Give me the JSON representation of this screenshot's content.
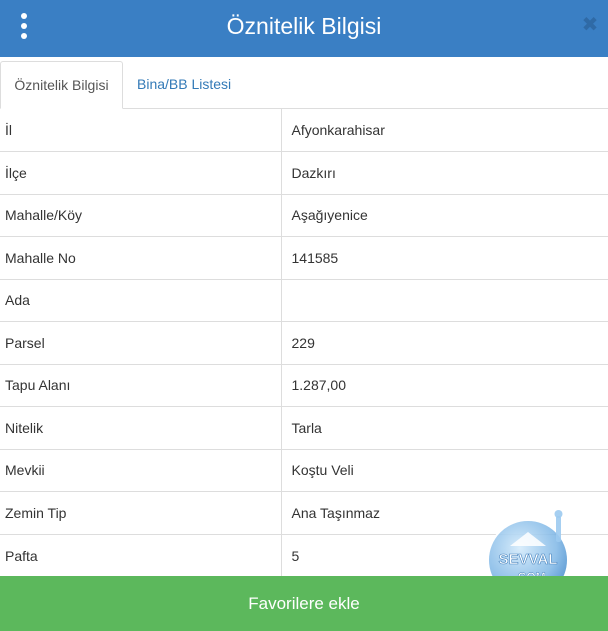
{
  "header": {
    "title": "Öznitelik Bilgisi",
    "menu_icon": "vertical-dots-icon",
    "close_icon": "close-icon",
    "color": "#3a7fc4"
  },
  "tabs": [
    {
      "label": "Öznitelik Bilgisi",
      "active": true
    },
    {
      "label": "Bina/BB Listesi",
      "active": false
    }
  ],
  "attributes": [
    {
      "key": "İl",
      "value": "Afyonkarahisar"
    },
    {
      "key": "İlçe",
      "value": "Dazkırı"
    },
    {
      "key": "Mahalle/Köy",
      "value": "Aşağıyenice"
    },
    {
      "key": "Mahalle No",
      "value": "141585"
    },
    {
      "key": "Ada",
      "value": ""
    },
    {
      "key": "Parsel",
      "value": "229"
    },
    {
      "key": "Tapu Alanı",
      "value": "1.287,00"
    },
    {
      "key": "Nitelik",
      "value": "Tarla"
    },
    {
      "key": "Mevkii",
      "value": "Koştu Veli"
    },
    {
      "key": "Zemin Tip",
      "value": "Ana Taşınmaz"
    },
    {
      "key": "Pafta",
      "value": "5"
    }
  ],
  "watermark": {
    "brand": "SEVVAL",
    "domain": ".COM"
  },
  "footer": {
    "button_label": "Favorilere ekle",
    "color": "#5cb85c"
  }
}
